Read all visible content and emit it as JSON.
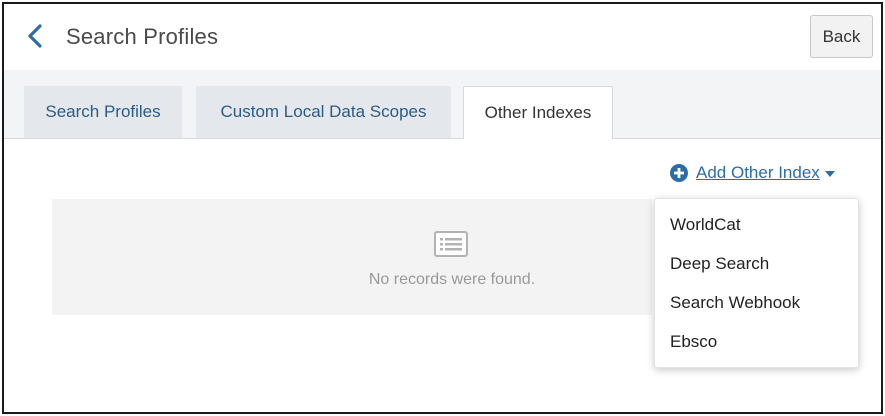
{
  "header": {
    "title": "Search Profiles",
    "back_label": "Back"
  },
  "tabs": [
    {
      "label": "Search Profiles",
      "active": false
    },
    {
      "label": "Custom Local Data Scopes",
      "active": false
    },
    {
      "label": "Other Indexes",
      "active": true
    }
  ],
  "actions": {
    "add_other_index_label": "Add Other Index"
  },
  "empty_state": {
    "message": "No records were found."
  },
  "dropdown": {
    "items": [
      "WorldCat",
      "Deep Search",
      "Search Webhook",
      "Ebsco"
    ]
  },
  "colors": {
    "accent": "#2c6ca8",
    "tab_bar": "#f3f4f5",
    "inactive_tab": "#e4e7eb",
    "empty_panel": "#f3f3f3"
  },
  "icons": {
    "back": "chevron-left-icon",
    "add": "plus-circle-icon",
    "dropdown": "caret-down-icon",
    "empty": "list-icon"
  }
}
